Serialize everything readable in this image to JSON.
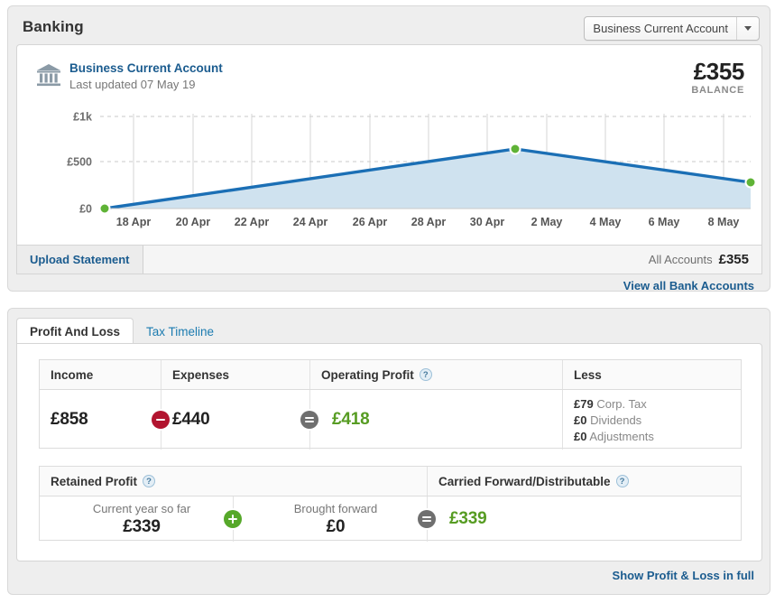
{
  "banking": {
    "title": "Banking",
    "account_selector": {
      "value": "Business Current Account",
      "icon": "chevron-down-icon"
    },
    "account": {
      "name": "Business Current Account",
      "last_updated": "Last updated 07 May 19",
      "icon": "bank-icon"
    },
    "balance": {
      "amount": "£355",
      "label": "BALANCE"
    },
    "upload_statement_label": "Upload Statement",
    "all_accounts_label": "All Accounts",
    "all_accounts_amount": "£355",
    "view_all_link": "View all Bank Accounts"
  },
  "chart_data": {
    "type": "area",
    "title": "",
    "xlabel": "",
    "ylabel": "",
    "ylim": [
      0,
      1000
    ],
    "ytick_labels": [
      "£0",
      "£500",
      "£1k"
    ],
    "ytick_values": [
      0,
      500,
      1000
    ],
    "categories": [
      "18 Apr",
      "20 Apr",
      "22 Apr",
      "24 Apr",
      "26 Apr",
      "28 Apr",
      "30 Apr",
      "2 May",
      "4 May",
      "6 May",
      "8 May"
    ],
    "x": [
      "17 Apr",
      "1 May",
      "9 May"
    ],
    "values": [
      0,
      630,
      355
    ],
    "marker_points": [
      {
        "label": "17 Apr",
        "value": 0
      },
      {
        "label": "1 May",
        "value": 630
      },
      {
        "label": "9 May",
        "value": 355
      }
    ],
    "grid": true,
    "legend": "none",
    "line_color": "#1b6fb5",
    "fill_color": "#cfe2ef",
    "marker_color": "#5fb336"
  },
  "profit_and_loss": {
    "tabs": [
      {
        "label": "Profit And Loss",
        "active": true
      },
      {
        "label": "Tax Timeline",
        "active": false
      }
    ],
    "top_table": {
      "headers": [
        "Income",
        "Expenses",
        "Operating Profit",
        "Less"
      ],
      "operating_profit_has_help": true,
      "income": "£858",
      "expenses": "£440",
      "operating_profit": "£418",
      "less_items": [
        {
          "amount": "£79",
          "label": "Corp. Tax"
        },
        {
          "amount": "£0",
          "label": "Dividends"
        },
        {
          "amount": "£0",
          "label": "Adjustments"
        }
      ],
      "operators": [
        "minus-icon",
        "equals-icon"
      ]
    },
    "bottom_table": {
      "headers": [
        "Retained Profit",
        "Carried Forward/Distributable"
      ],
      "current_year_label": "Current year so far",
      "current_year_value": "£339",
      "brought_forward_label": "Brought forward",
      "brought_forward_value": "£0",
      "carried_forward_value": "£339",
      "operators": [
        "plus-icon",
        "equals-icon"
      ]
    },
    "show_full_link": "Show Profit & Loss in full"
  },
  "colors": {
    "accent_blue": "#1b5c8f",
    "link_blue": "#1b7bb0",
    "green": "#579c23",
    "red": "#b2142f",
    "grey": "#6f6f6f"
  }
}
